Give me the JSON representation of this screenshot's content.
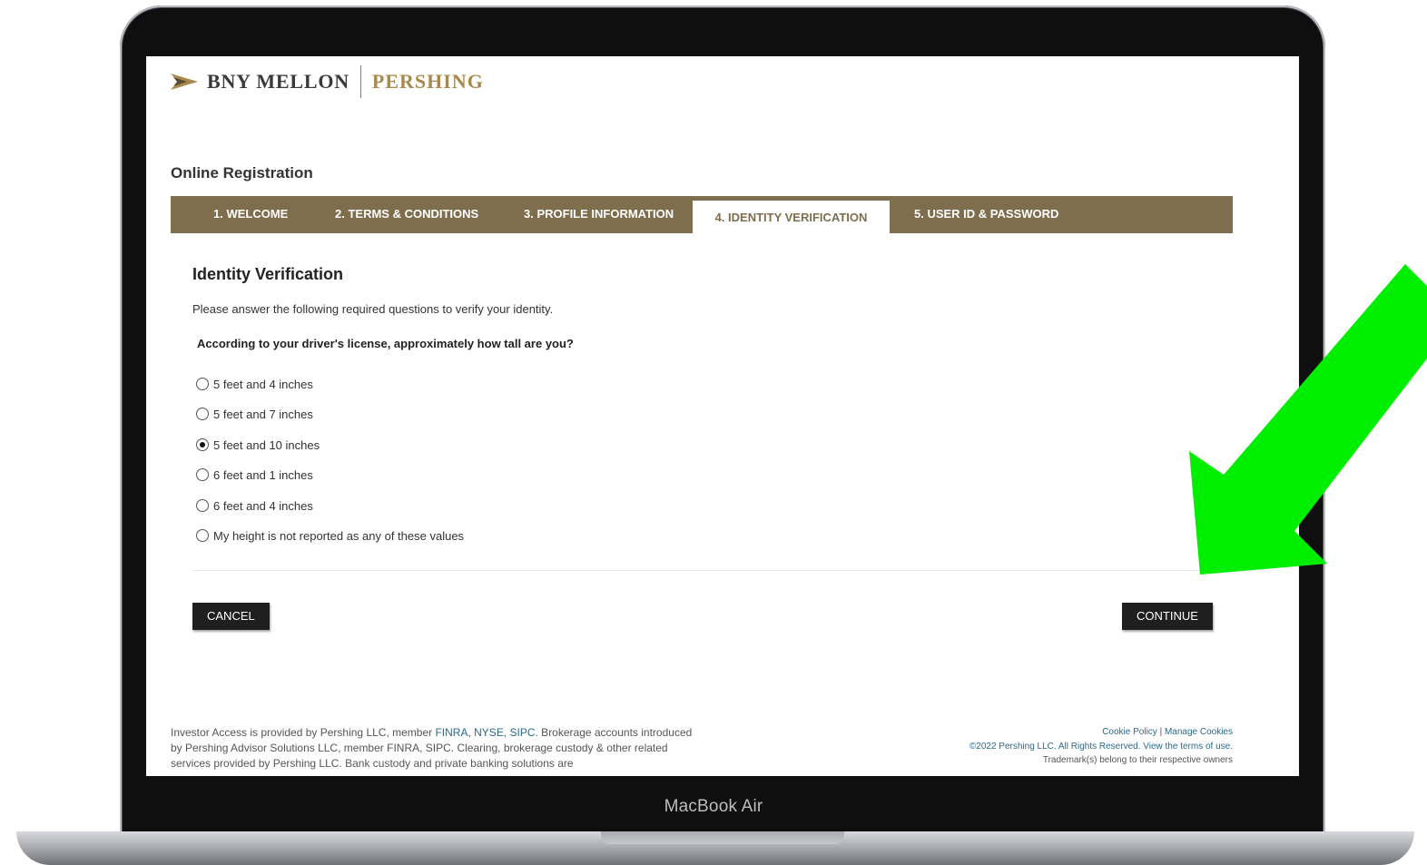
{
  "device": {
    "label": "MacBook Air"
  },
  "brand": {
    "name_left": "BNY MELLON",
    "name_right": "PERSHING",
    "colors": {
      "gold": "#a88a4d",
      "step_bar": "#7f6e4e"
    }
  },
  "page": {
    "title": "Online Registration"
  },
  "steps": [
    {
      "label": "1. WELCOME",
      "active": false
    },
    {
      "label": "2. TERMS & CONDITIONS",
      "active": false
    },
    {
      "label": "3. PROFILE INFORMATION",
      "active": false
    },
    {
      "label": "4. IDENTITY VERIFICATION",
      "active": true
    },
    {
      "label": "5. USER ID & PASSWORD",
      "active": false
    }
  ],
  "verification": {
    "title": "Identity Verification",
    "instructions": "Please answer the following required questions to verify your identity.",
    "question": "According to your driver's license, approximately how tall are you?",
    "options": [
      {
        "label": "5 feet and 4 inches",
        "selected": false
      },
      {
        "label": "5 feet and 7 inches",
        "selected": false
      },
      {
        "label": "5 feet and 10 inches",
        "selected": true
      },
      {
        "label": "6 feet and 1 inches",
        "selected": false
      },
      {
        "label": "6 feet and 4 inches",
        "selected": false
      },
      {
        "label": "My height is not reported as any of these values",
        "selected": false
      }
    ]
  },
  "buttons": {
    "cancel": "CANCEL",
    "continue": "CONTINUE"
  },
  "footer": {
    "left_1": "Investor Access is provided by Pershing LLC, member ",
    "finra": "FINRA",
    "comma1": ", ",
    "nyse": "NYSE",
    "comma2": ", ",
    "sipc": "SIPC",
    "left_2": ". Brokerage accounts introduced by Pershing Advisor Solutions LLC, member FINRA, SIPC. Clearing, brokerage custody & other related services provided by Pershing LLC. Bank custody and private banking solutions are",
    "cookie_policy": "Cookie Policy",
    "sep": " | ",
    "manage_cookies": "Manage Cookies",
    "copyright": "©2022 Pershing LLC. All Rights Reserved. View the terms of use.",
    "trademark": "Trademark(s) belong to their respective owners"
  },
  "annotation": {
    "arrow_color": "#00ee00"
  }
}
